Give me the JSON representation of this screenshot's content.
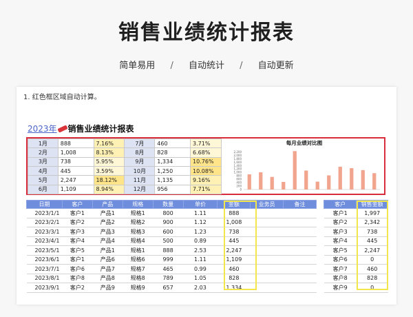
{
  "header": {
    "title": "销售业绩统计报表",
    "tags": [
      "简单易用",
      "自动统计",
      "自动更新"
    ],
    "separator": "/"
  },
  "sheet": {
    "note": "1. 红色框区域自动计算。",
    "report_year": "2023年",
    "report_title": "销售业绩统计报表",
    "summary": [
      {
        "month": "1月",
        "value": "888",
        "pct": "7.16%"
      },
      {
        "month": "2月",
        "value": "1,008",
        "pct": "8.13%"
      },
      {
        "month": "3月",
        "value": "738",
        "pct": "5.95%"
      },
      {
        "month": "4月",
        "value": "445",
        "pct": "3.59%"
      },
      {
        "month": "5月",
        "value": "2,247",
        "pct": "18.12%"
      },
      {
        "month": "6月",
        "value": "1,109",
        "pct": "8.94%"
      },
      {
        "month": "7月",
        "value": "460",
        "pct": "3.71%"
      },
      {
        "month": "8月",
        "value": "828",
        "pct": "6.68%"
      },
      {
        "month": "9月",
        "value": "1,334",
        "pct": "10.76%"
      },
      {
        "month": "10月",
        "value": "1,250",
        "pct": "10.08%"
      },
      {
        "month": "11月",
        "value": "1,135",
        "pct": "9.16%"
      },
      {
        "month": "12月",
        "value": "956",
        "pct": "7.71%"
      }
    ],
    "table": {
      "headers": [
        "日期",
        "客户",
        "产品",
        "规格",
        "数量",
        "单价",
        "金额",
        "业务员",
        "备注"
      ],
      "rows": [
        [
          "2023/1/1",
          "客户1",
          "产品1",
          "规格1",
          "800",
          "1.11",
          "888",
          "",
          ""
        ],
        [
          "2023/2/1",
          "客户2",
          "产品2",
          "规格2",
          "900",
          "1.12",
          "1,008",
          "",
          ""
        ],
        [
          "2023/3/1",
          "客户3",
          "产品3",
          "规格3",
          "600",
          "1.23",
          "738",
          "",
          ""
        ],
        [
          "2023/4/1",
          "客户4",
          "产品4",
          "规格4",
          "500",
          "0.89",
          "445",
          "",
          ""
        ],
        [
          "2023/5/1",
          "客户5",
          "产品1",
          "规格1",
          "888",
          "2.53",
          "2,247",
          "",
          ""
        ],
        [
          "2023/6/1",
          "客户1",
          "产品6",
          "规格6",
          "999",
          "1.11",
          "1,109",
          "",
          ""
        ],
        [
          "2023/7/1",
          "客户6",
          "产品7",
          "规格7",
          "465",
          "0.99",
          "460",
          "",
          ""
        ],
        [
          "2023/8/1",
          "客户8",
          "产品8",
          "规格8",
          "789",
          "1.05",
          "828",
          "",
          ""
        ],
        [
          "2023/9/1",
          "客户2",
          "产品9",
          "规格9",
          "657",
          "2.03",
          "1,334",
          "",
          ""
        ]
      ]
    },
    "side_table": {
      "headers": [
        "客户",
        "销售金额"
      ],
      "rows": [
        [
          "客户1",
          "1,997"
        ],
        [
          "客户2",
          "2,342"
        ],
        [
          "客户3",
          "738"
        ],
        [
          "客户4",
          "445"
        ],
        [
          "客户5",
          "2,247"
        ],
        [
          "客户6",
          "0"
        ],
        [
          "客户7",
          "460"
        ],
        [
          "客户8",
          "828"
        ],
        [
          "客户9",
          "0"
        ]
      ]
    }
  },
  "colors": {
    "accent": "#6f8ddd",
    "red_frame": "#d82c3a",
    "yellow_frame": "#f3e64a",
    "bar": "#f2a58e"
  },
  "chart_data": {
    "type": "bar",
    "title": "每月业绩对比图",
    "categories": [
      "1月",
      "2月",
      "3月",
      "4月",
      "5月",
      "6月",
      "7月",
      "8月",
      "9月",
      "10月",
      "11月",
      "12月"
    ],
    "values": [
      888,
      1008,
      738,
      445,
      2247,
      1109,
      460,
      828,
      1334,
      1250,
      1135,
      956
    ],
    "ylim": [
      0,
      2500
    ],
    "yticks": [
      "0",
      "200",
      "400",
      "600",
      "800",
      "1,000",
      "1,200",
      "1,400",
      "1,600",
      "1,800",
      "2,000",
      "2,200"
    ],
    "ytick_values": [
      0,
      200,
      400,
      600,
      800,
      1000,
      1200,
      1400,
      1600,
      1800,
      2000,
      2200
    ],
    "xlabel": "",
    "ylabel": "",
    "grid": false
  }
}
